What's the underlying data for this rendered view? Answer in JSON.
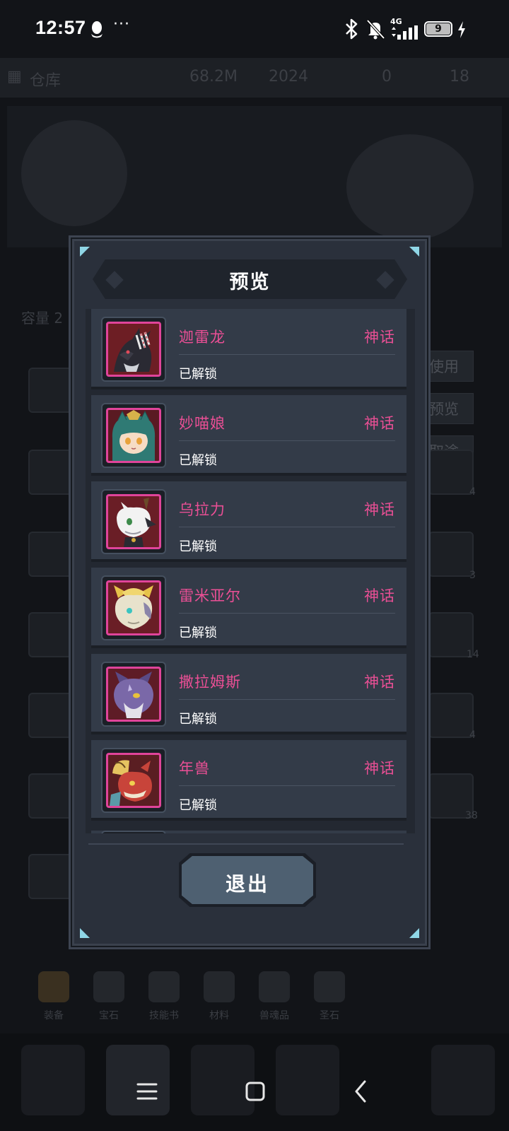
{
  "status_bar": {
    "time": "12:57",
    "more": "···",
    "network": "4G",
    "battery_level": "9",
    "icons": [
      "qq-penguin-icon",
      "bluetooth-icon",
      "bell-off-icon",
      "signal-icon",
      "battery-icon",
      "charging-bolt-icon"
    ]
  },
  "background": {
    "topbar": {
      "warehouse": "仓库",
      "value1": "68.2M",
      "value2": "2024",
      "value3": "0",
      "value4": "18"
    },
    "capacity_label": "容量 2",
    "side_buttons": [
      "使用",
      "预览",
      "取途径"
    ],
    "cell_badges": [
      "4",
      "3",
      "14",
      "4",
      "38"
    ],
    "bottom_tabs": [
      "装备",
      "宝石",
      "技能书",
      "材料",
      "兽魂品",
      "圣石"
    ]
  },
  "modal": {
    "title": "预览",
    "items": [
      {
        "name": "迦雷龙",
        "rarity": "神话",
        "status": "已解锁",
        "portrait": "black-dragon-portrait"
      },
      {
        "name": "妙喵娘",
        "rarity": "神话",
        "status": "已解锁",
        "portrait": "cat-girl-portrait"
      },
      {
        "name": "乌拉力",
        "rarity": "神话",
        "status": "已解锁",
        "portrait": "white-horned-beast-portrait"
      },
      {
        "name": "雷米亚尔",
        "rarity": "神话",
        "status": "已解锁",
        "portrait": "golden-horned-wolf-portrait"
      },
      {
        "name": "撒拉姆斯",
        "rarity": "神话",
        "status": "已解锁",
        "portrait": "purple-beast-portrait"
      },
      {
        "name": "年兽",
        "rarity": "神话",
        "status": "已解锁",
        "portrait": "red-dragon-portrait"
      }
    ],
    "exit_label": "退出"
  },
  "colors": {
    "rarity_mythic": "#ea4f95",
    "portrait_border": "#e0449a",
    "modal_bg": "#2a303b",
    "card_bg": "#333b48",
    "exit_button": "#4e6071",
    "corner_accent": "#8fd6e6"
  },
  "system_nav": [
    "menu-icon",
    "home-square-icon",
    "back-chevron-icon"
  ]
}
